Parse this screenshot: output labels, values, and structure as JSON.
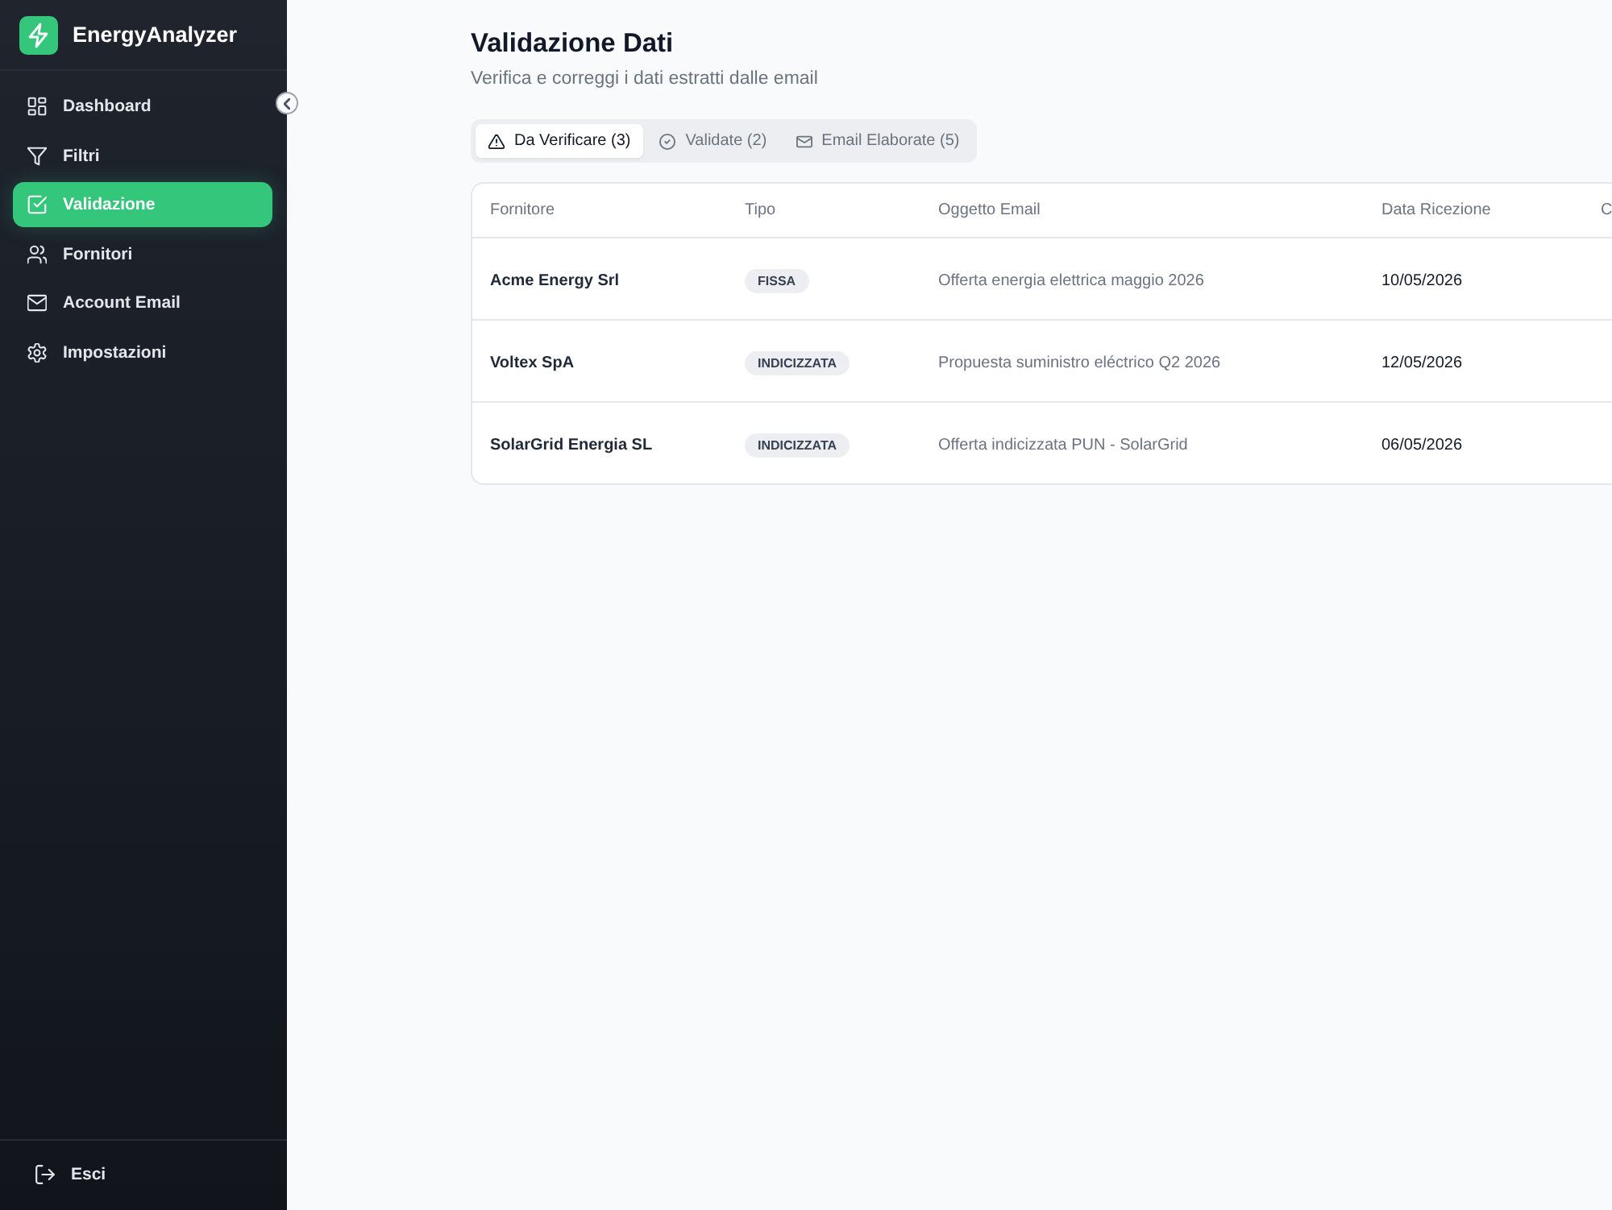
{
  "sidebar": {
    "app_name": "EnergyAnalyzer",
    "items": [
      {
        "label": "Dashboard",
        "selected": false
      },
      {
        "label": "Filtri",
        "selected": false
      },
      {
        "label": "Validazione",
        "selected": true
      },
      {
        "label": "Fornitori",
        "selected": false
      },
      {
        "label": "Account Email",
        "selected": false
      },
      {
        "label": "Impostazioni",
        "selected": false
      }
    ],
    "logout": "Esci"
  },
  "header": {
    "title": "Validazione Dati",
    "subtitle": "Verifica e correggi i dati estratti dalle email"
  },
  "tabs": [
    {
      "label": "Da Verificare (3)",
      "selected": true
    },
    {
      "label": "Validate (2)",
      "selected": false
    },
    {
      "label": "Email Elaborate (5)",
      "selected": false
    }
  ],
  "table": {
    "columns": [
      "Fornitore",
      "Tipo",
      "Oggetto Email",
      "Data Ricezione",
      "C"
    ],
    "rows": [
      {
        "supplier": "Acme Energy Srl",
        "type": "FISSA",
        "subject": "Offerta energia elettrica maggio 2026",
        "date": "10/05/2026"
      },
      {
        "supplier": "Voltex SpA",
        "type": "INDICIZZATA",
        "subject": "Propuesta suministro eléctrico Q2 2026",
        "date": "12/05/2026"
      },
      {
        "supplier": "SolarGrid Energia SL",
        "type": "INDICIZZATA",
        "subject": "Offerta indicizzata PUN - SolarGrid",
        "date": "06/05/2026"
      }
    ]
  }
}
